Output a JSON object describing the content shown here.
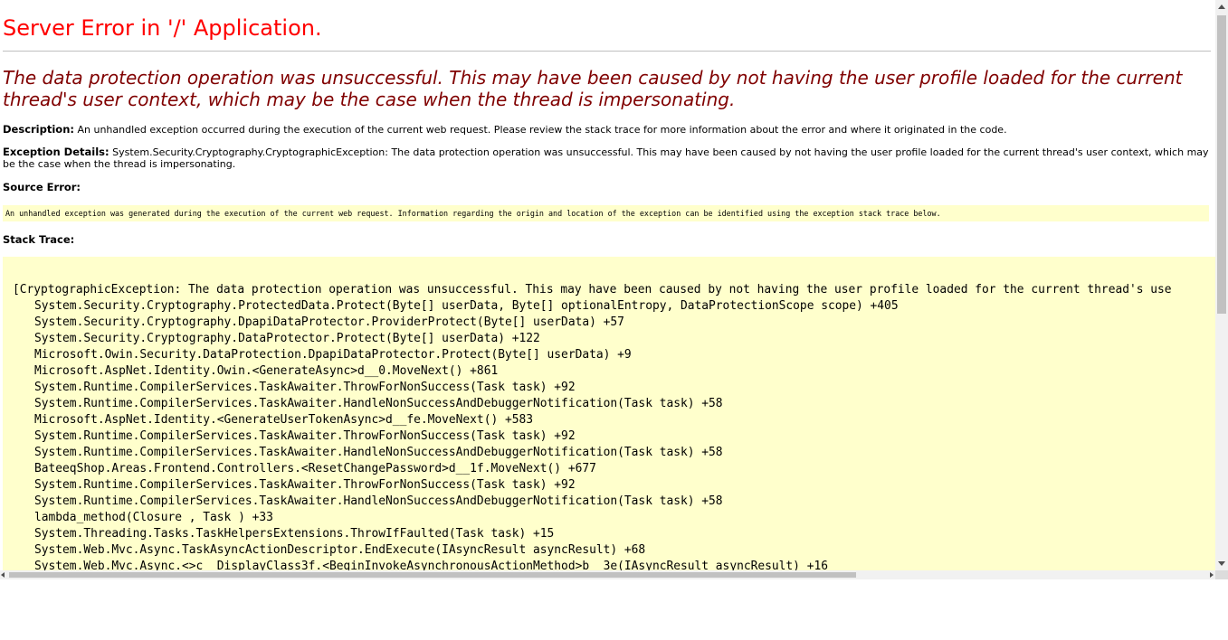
{
  "page": {
    "title": "Server Error in '/' Application.",
    "message": "The data protection operation was unsuccessful. This may have been caused by not having the user profile loaded for the current thread's user context, which may be the case when the thread is impersonating.",
    "description_label": "Description:",
    "description_text": " An unhandled exception occurred during the execution of the current web request. Please review the stack trace for more information about the error and where it originated in the code.",
    "exception_label": "Exception Details:",
    "exception_text": " System.Security.Cryptography.CryptographicException: The data protection operation was unsuccessful. This may have been caused by not having the user profile loaded for the current thread's user context, which may be the case when the thread is impersonating.",
    "source_error_label": "Source Error:",
    "source_error_text": "An unhandled exception was generated during the execution of the current web request. Information regarding the origin and location of the exception can be identified using the exception stack trace below.",
    "stack_trace_label": "Stack Trace:"
  },
  "stack_trace": {
    "head": "[CryptographicException: The data protection operation was unsuccessful. This may have been caused by not having the user profile loaded for the current thread's use",
    "frames": [
      "System.Security.Cryptography.ProtectedData.Protect(Byte[] userData, Byte[] optionalEntropy, DataProtectionScope scope) +405",
      "System.Security.Cryptography.DpapiDataProtector.ProviderProtect(Byte[] userData) +57",
      "System.Security.Cryptography.DataProtector.Protect(Byte[] userData) +122",
      "Microsoft.Owin.Security.DataProtection.DpapiDataProtector.Protect(Byte[] userData) +9",
      "Microsoft.AspNet.Identity.Owin.<GenerateAsync>d__0.MoveNext() +861",
      "System.Runtime.CompilerServices.TaskAwaiter.ThrowForNonSuccess(Task task) +92",
      "System.Runtime.CompilerServices.TaskAwaiter.HandleNonSuccessAndDebuggerNotification(Task task) +58",
      "Microsoft.AspNet.Identity.<GenerateUserTokenAsync>d__fe.MoveNext() +583",
      "System.Runtime.CompilerServices.TaskAwaiter.ThrowForNonSuccess(Task task) +92",
      "System.Runtime.CompilerServices.TaskAwaiter.HandleNonSuccessAndDebuggerNotification(Task task) +58",
      "BateeqShop.Areas.Frontend.Controllers.<ResetChangePassword>d__1f.MoveNext() +677",
      "System.Runtime.CompilerServices.TaskAwaiter.ThrowForNonSuccess(Task task) +92",
      "System.Runtime.CompilerServices.TaskAwaiter.HandleNonSuccessAndDebuggerNotification(Task task) +58",
      "lambda_method(Closure , Task ) +33",
      "System.Threading.Tasks.TaskHelpersExtensions.ThrowIfFaulted(Task task) +15",
      "System.Web.Mvc.Async.TaskAsyncActionDescriptor.EndExecute(IAsyncResult asyncResult) +68",
      "System.Web.Mvc.Async.<>c__DisplayClass3f.<BeginInvokeAsynchronousActionMethod>b__3e(IAsyncResult asyncResult) +16"
    ]
  },
  "colors": {
    "title": "#ff0000",
    "message": "#800000",
    "code_background": "#ffffcc",
    "rule": "#c0c0c0"
  },
  "icons": {
    "scroll_up": "arrow-up-icon",
    "scroll_down": "arrow-down-icon",
    "scroll_left": "arrow-left-icon",
    "scroll_right": "arrow-right-icon"
  }
}
